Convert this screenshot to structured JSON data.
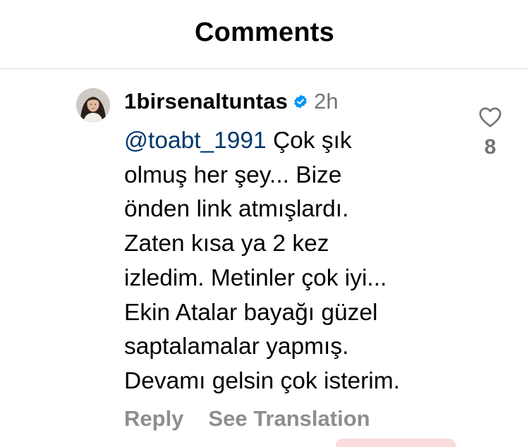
{
  "header": {
    "title": "Comments"
  },
  "comment": {
    "username": "1birsenaltuntas",
    "verified": true,
    "time": "2h",
    "mention": "@toabt_1991",
    "lines": [
      " Çok şık",
      "olmuş her şey... Bize",
      "önden link atmışlardı.",
      "Zaten kısa ya 2 kez",
      "izledim. Metinler çok iyi...",
      "Ekin Atalar bayağı güzel",
      "saptalamalar yapmış.",
      "Devamı gelsin çok isterim."
    ],
    "like_count": "8",
    "icons": {
      "like": "heart-outline-icon",
      "verified": "verified-badge-icon"
    }
  },
  "actions": {
    "reply_label": "Reply",
    "translate_label": "See Translation"
  },
  "colors": {
    "mention": "#00376b",
    "secondary_text": "#737373",
    "action_text": "#8e8e8e",
    "verified_badge": "#0095f6",
    "divider": "#dbdbdb"
  }
}
